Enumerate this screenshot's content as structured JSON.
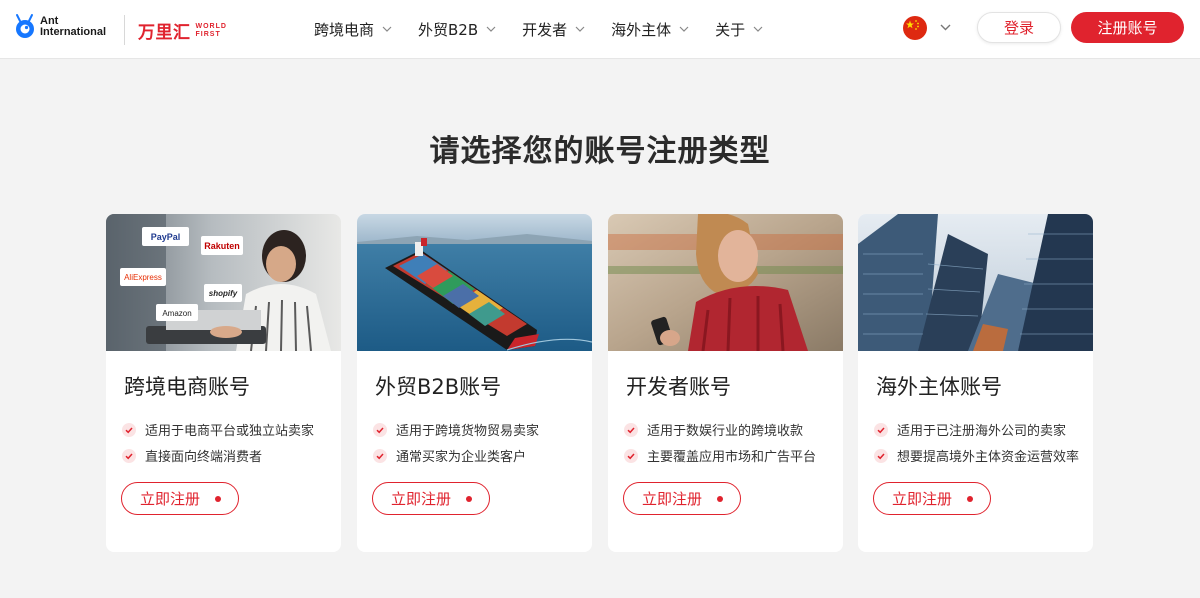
{
  "brand": {
    "ant_line1": "Ant",
    "ant_line2": "International",
    "wf_cn": "万里汇",
    "wf_en_line1": "WORLD",
    "wf_en_line2": "FIRST"
  },
  "nav": {
    "items": [
      {
        "label": "跨境电商"
      },
      {
        "label": "外贸B2B"
      },
      {
        "label": "开发者"
      },
      {
        "label": "海外主体"
      },
      {
        "label": "关于"
      }
    ]
  },
  "header": {
    "language_icon": "china-flag-icon",
    "login_label": "登录",
    "register_label": "注册账号"
  },
  "main": {
    "title": "请选择您的账号注册类型",
    "cards": [
      {
        "title": "跨境电商账号",
        "features": [
          "适用于电商平台或独立站卖家",
          "直接面向终端消费者"
        ],
        "button": "立即注册",
        "logos": [
          "PayPal",
          "Rakuten",
          "AliExpress",
          "shopify",
          "Amazon"
        ]
      },
      {
        "title": "外贸B2B账号",
        "features": [
          "适用于跨境货物贸易卖家",
          "通常买家为企业类客户"
        ],
        "button": "立即注册"
      },
      {
        "title": "开发者账号",
        "features": [
          "适用于数娱行业的跨境收款",
          "主要覆盖应用市场和广告平台"
        ],
        "button": "立即注册"
      },
      {
        "title": "海外主体账号",
        "features": [
          "适用于已注册海外公司的卖家",
          "想要提高境外主体资金运营效率"
        ],
        "button": "立即注册"
      }
    ]
  },
  "colors": {
    "brand_red": "#e0232e",
    "page_bg": "#f3f3f3",
    "ant_blue": "#1677ff"
  }
}
